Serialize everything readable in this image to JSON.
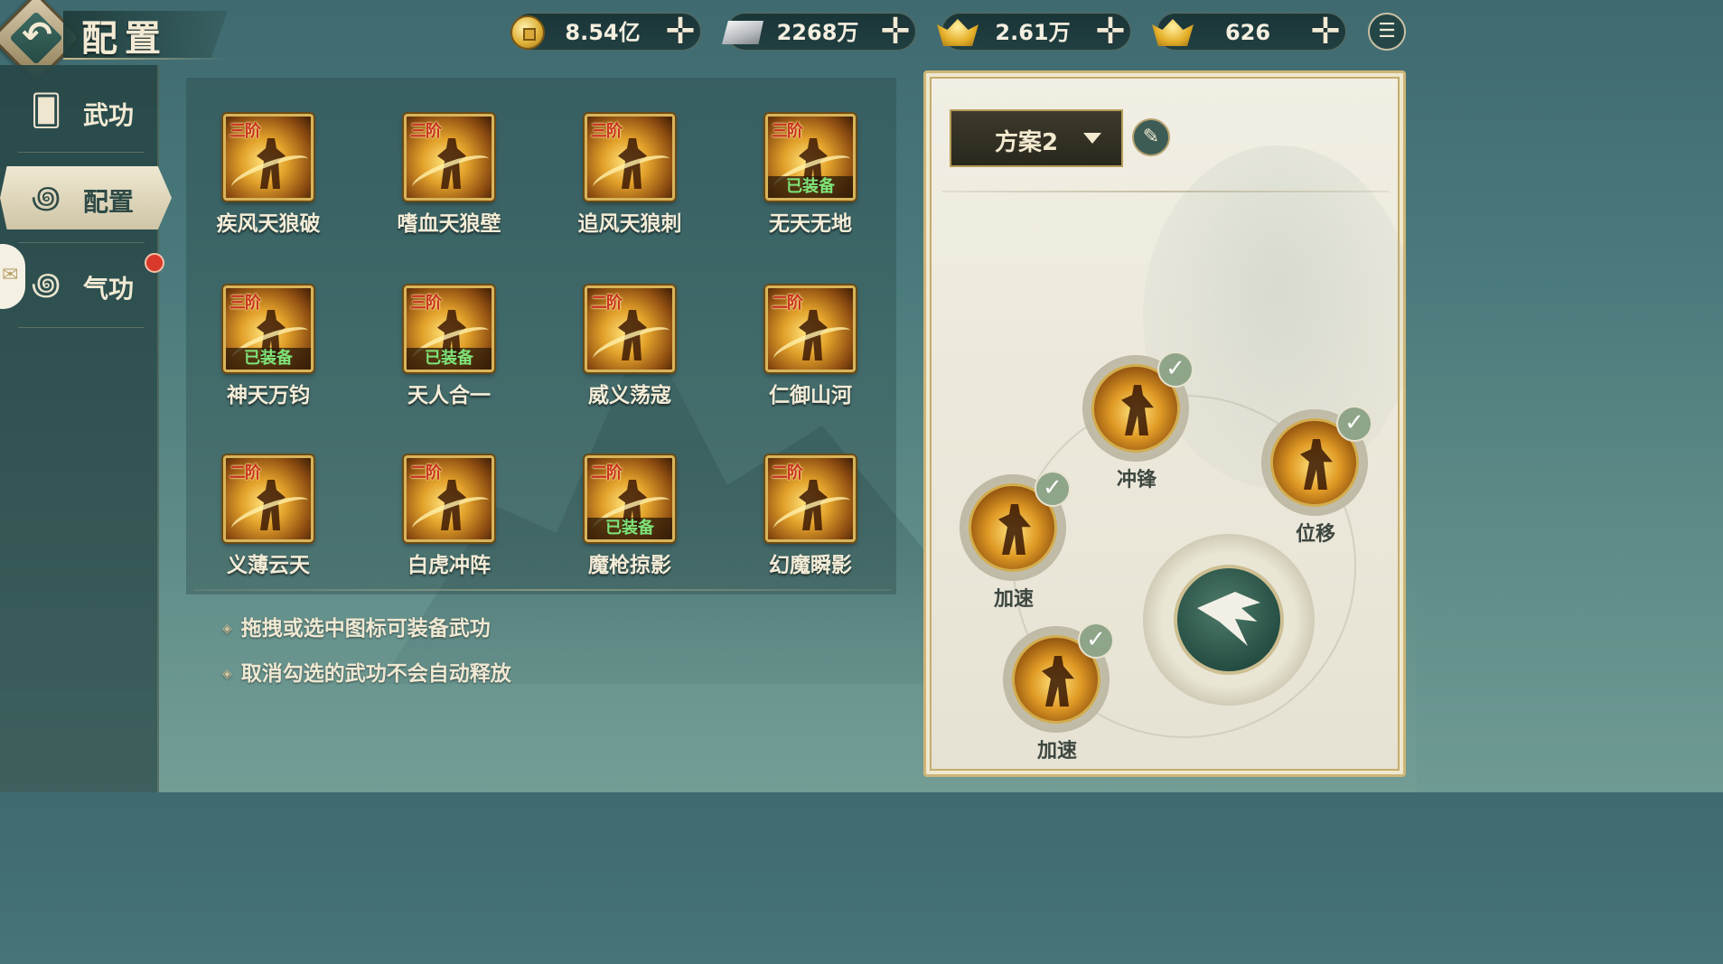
{
  "header": {
    "title": "配置",
    "back_icon": "back-arrow-icon",
    "currencies": [
      {
        "icon": "copper-coin-icon",
        "value": "8.54亿"
      },
      {
        "icon": "silver-ingot-icon",
        "value": "2268万"
      },
      {
        "icon": "bound-gold-ingot-icon",
        "value": "2.61万"
      },
      {
        "icon": "gold-ingot-icon",
        "value": "626"
      }
    ],
    "add_icon": "plus-icon",
    "menu_icon": "list-menu-icon"
  },
  "sidebar": {
    "items": [
      {
        "label": "武功",
        "icon": "cards-icon",
        "active": false
      },
      {
        "label": "配置",
        "icon": "swirl-icon",
        "active": true
      },
      {
        "label": "气功",
        "icon": "swirl-icon",
        "active": false,
        "badge": true
      }
    ]
  },
  "skills": [
    {
      "rank": "三阶",
      "name": "疾风天狼破",
      "equipped": ""
    },
    {
      "rank": "三阶",
      "name": "嗜血天狼壁",
      "equipped": ""
    },
    {
      "rank": "三阶",
      "name": "追风天狼刺",
      "equipped": ""
    },
    {
      "rank": "三阶",
      "name": "无天无地",
      "equipped": "已装备"
    },
    {
      "rank": "三阶",
      "name": "神天万钧",
      "equipped": "已装备"
    },
    {
      "rank": "三阶",
      "name": "天人合一",
      "equipped": "已装备"
    },
    {
      "rank": "二阶",
      "name": "威义荡寇",
      "equipped": ""
    },
    {
      "rank": "二阶",
      "name": "仁御山河",
      "equipped": ""
    },
    {
      "rank": "二阶",
      "name": "义薄云天",
      "equipped": ""
    },
    {
      "rank": "二阶",
      "name": "白虎冲阵",
      "equipped": ""
    },
    {
      "rank": "二阶",
      "name": "魔枪掠影",
      "equipped": "已装备"
    },
    {
      "rank": "二阶",
      "name": "幻魔瞬影",
      "equipped": ""
    }
  ],
  "tips": [
    "拖拽或选中图标可装备武功",
    "取消勾选的武功不会自动释放"
  ],
  "config": {
    "scheme": "方案2",
    "edit_icon": "edit-icon",
    "slots": [
      {
        "label": "冲锋",
        "checked": true
      },
      {
        "label": "位移",
        "checked": true
      },
      {
        "label": "加速",
        "checked": true
      },
      {
        "label": "加速",
        "checked": true
      }
    ],
    "attack_icon": "sword-attack-icon"
  },
  "colors": {
    "accent_gold": "#d8b45a",
    "equipped_green": "#7ee47a",
    "rank_red": "#c8311f",
    "badge_red": "#d8392b"
  }
}
